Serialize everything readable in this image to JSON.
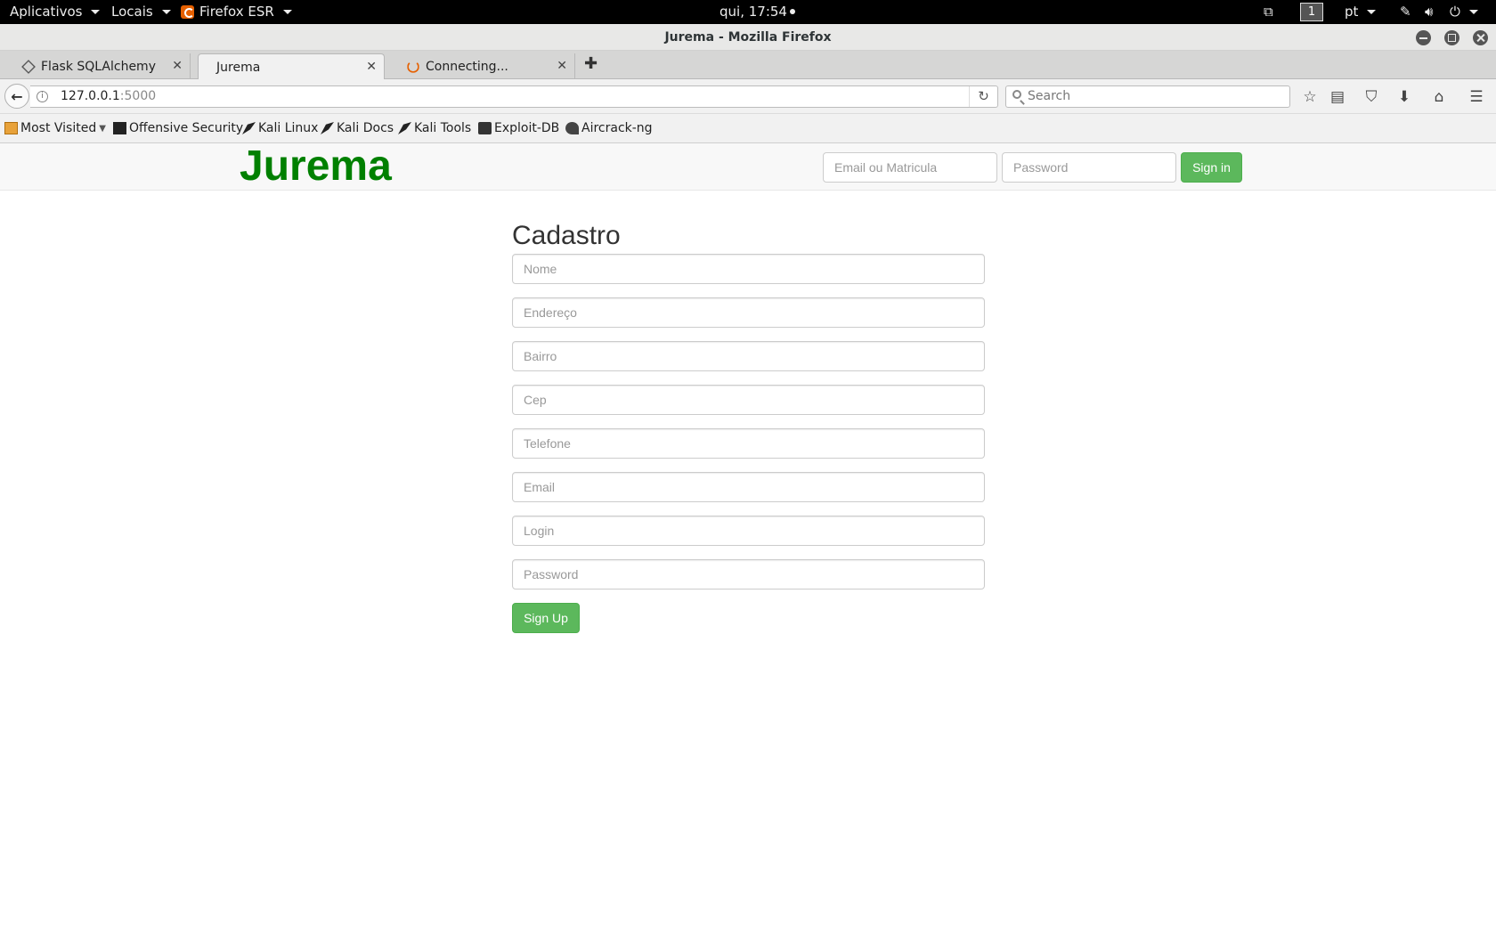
{
  "topbar": {
    "apps_label": "Aplicativos",
    "places_label": "Locais",
    "app_label": "Firefox ESR",
    "clock": "qui, 17:54",
    "workspace": "1",
    "language": "pt"
  },
  "window": {
    "title": "Jurema - Mozilla Firefox"
  },
  "tabs": [
    {
      "label": "Flask SQLAlchemy",
      "icon": "flask-icon",
      "active": false
    },
    {
      "label": "Jurema",
      "icon": "",
      "active": true
    },
    {
      "label": "Connecting...",
      "icon": "spinner-icon",
      "active": false
    }
  ],
  "navbar": {
    "url_host": "127.0.0.1",
    "url_port": ":5000",
    "search_placeholder": "Search"
  },
  "bookmarks": [
    {
      "label": "Most Visited",
      "icon": "folder-icon"
    },
    {
      "label": "Offensive Security",
      "icon": "offsec-icon"
    },
    {
      "label": "Kali Linux",
      "icon": "kali-dragon-icon"
    },
    {
      "label": "Kali Docs",
      "icon": "kali-dragon-icon"
    },
    {
      "label": "Kali Tools",
      "icon": "kali-dragon-icon"
    },
    {
      "label": "Exploit-DB",
      "icon": "exploitdb-icon"
    },
    {
      "label": "Aircrack-ng",
      "icon": "aircrack-icon"
    }
  ],
  "site": {
    "brand": "Jurema",
    "brand_color": "#008000",
    "accent_color": "#5cb85c",
    "login": {
      "email_placeholder": "Email ou Matricula",
      "password_placeholder": "Password",
      "signin_label": "Sign in"
    },
    "form": {
      "title": "Cadastro",
      "fields": {
        "nome": "Nome",
        "endereco": "Endereço",
        "bairro": "Bairro",
        "cep": "Cep",
        "telefone": "Telefone",
        "email": "Email",
        "login": "Login",
        "password": "Password"
      },
      "submit_label": "Sign Up"
    }
  }
}
